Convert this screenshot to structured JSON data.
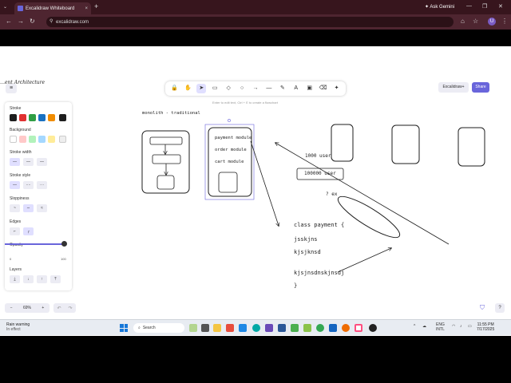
{
  "browser": {
    "tab_title": "Excalidraw Whiteboard",
    "tab_close": "×",
    "new_tab": "+",
    "tab_list": "⌄",
    "ask_gemini": "✦ Ask Gemini",
    "url": "excalidraw.com",
    "avatar_letter": "U",
    "win_minimize": "—",
    "win_restore": "❐",
    "win_close": "✕"
  },
  "nav": {
    "back": "←",
    "forward": "→",
    "reload": "↻",
    "site_info": "⚲",
    "cast": "⌂",
    "star": "☆",
    "extensions": "⧉",
    "more": "⋮"
  },
  "toolbar": {
    "tools": [
      "🔒",
      "✋",
      "➤",
      "▭",
      "◇",
      "○",
      "→",
      "—",
      "✎",
      "A",
      "▣",
      "⌫",
      "✦"
    ],
    "active_index": 2,
    "hint": "Enter to edit text, Ctrl + E to create a flowchart"
  },
  "header": {
    "menu": "≡",
    "doc_title": "…ent Architecture",
    "library_label": "Excalidraw+",
    "share_label": "Share"
  },
  "panel": {
    "stroke_label": "Stroke",
    "stroke_colors": [
      "#1e1e1e",
      "#e03131",
      "#2f9e44",
      "#1971c2",
      "#f08c00",
      "#1e1e1e"
    ],
    "background_label": "Background",
    "background_colors": [
      "#ffffff",
      "#ffc9c9",
      "#b2f2bb",
      "#a5d8ff",
      "#ffec99",
      "#eeeeee"
    ],
    "stroke_width_label": "Stroke width",
    "stroke_style_label": "Stroke style",
    "sloppiness_label": "Sloppiness",
    "edges_label": "Edges",
    "opacity_label": "Opacity",
    "opacity_min": "0",
    "opacity_max": "100",
    "layers_label": "Layers",
    "width_glyphs": [
      "—",
      "—",
      "—"
    ],
    "style_glyphs": [
      "—",
      "- -",
      "···"
    ],
    "sloppy_glyphs": [
      "~",
      "∽",
      "≈"
    ],
    "edge_glyphs": [
      "⌐",
      "╭"
    ],
    "layer_glyphs": [
      "⤓",
      "↓",
      "↑",
      "⤒"
    ]
  },
  "bottom": {
    "zoom_out": "−",
    "zoom_level": "69%",
    "zoom_in": "+",
    "undo": "↶",
    "redo": "↷",
    "shield": "⛉",
    "help": "?"
  },
  "canvas": {
    "monolith_title": "monolith - traditional",
    "modules": [
      "payment module",
      "order module",
      "cart module"
    ],
    "users_text": "1000 user",
    "users_box_text": "100000 user",
    "question": "? ex",
    "code_lines": [
      "class payment {",
      "jsskjns",
      "kjsjknsd",
      "kjsjnsdnskjnsdj",
      "}"
    ]
  },
  "taskbar": {
    "weather_title": "Rain warning",
    "weather_sub": "In effect",
    "search_label": "Search",
    "lang_top": "ENG",
    "lang_bottom": "INTL",
    "time": "11:55 PM",
    "date": "7/17/2025"
  }
}
